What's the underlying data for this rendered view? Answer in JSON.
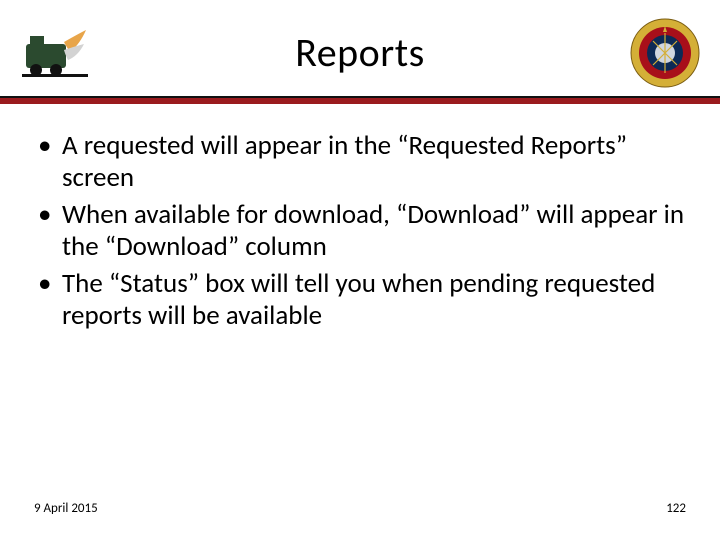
{
  "header": {
    "title": "Reports"
  },
  "bullets": [
    "A requested will appear in the “Requested Reports” screen",
    "When available for download, “Download” will appear in the “Download” column",
    "The “Status” box will tell you when pending requested reports will be available"
  ],
  "footer": {
    "date": "9 April 2015",
    "page": "122"
  }
}
